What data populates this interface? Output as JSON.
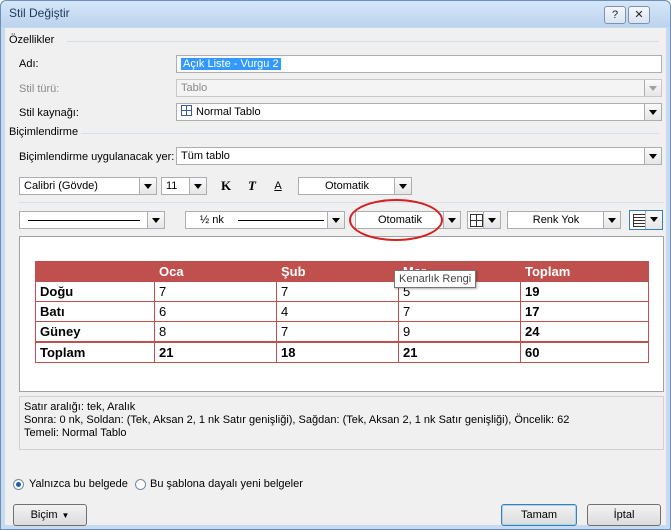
{
  "window": {
    "title": "Stil Değiştir",
    "buttons": [
      "?",
      "✕"
    ]
  },
  "properties": {
    "section": "Özellikler",
    "name_label": "Adı:",
    "name_value": "Açık Liste - Vurgu 2",
    "type_label": "Stil türü:",
    "type_value": "Tablo",
    "base_label": "Stil kaynağı:",
    "base_value": "Normal Tablo"
  },
  "formatting": {
    "section": "Biçimlendirme",
    "apply_label": "Biçimlendirme uygulanacak yer:",
    "apply_value": "Tüm tablo",
    "font_value": "Calibri (Gövde)",
    "size_value": "11",
    "bold_label": "K",
    "italic_label": "T",
    "underline_label": "A",
    "color_value": "Otomatik",
    "line_weight_value": "½ nk",
    "border_color_value": "Otomatik",
    "shading_value": "Renk Yok",
    "tooltip": "Kenarlık Rengi"
  },
  "preview_table": {
    "header": [
      "",
      "Oca",
      "Şub",
      "Mar",
      "Toplam"
    ],
    "rows": [
      [
        "Doğu",
        "7",
        "7",
        "5",
        "19"
      ],
      [
        "Batı",
        "6",
        "4",
        "7",
        "17"
      ],
      [
        "Güney",
        "8",
        "7",
        "9",
        "24"
      ],
      [
        "Toplam",
        "21",
        "18",
        "21",
        "60"
      ]
    ]
  },
  "description": {
    "line1": "Satır aralığı:  tek, Aralık",
    "line2": "Sonra:  0 nk, Soldan:  (Tek, Aksan 2,  1 nk Satır genişliği), Sağdan:  (Tek, Aksan 2,  1 nk Satır genişliği), Öncelik: 62",
    "line3": "Temeli: Normal Tablo"
  },
  "options": {
    "only_this_doc": "Yalnızca bu belgede",
    "new_docs": "Bu şablona dayalı yeni belgeler"
  },
  "footer": {
    "format_button": "Biçim",
    "ok_button": "Tamam",
    "cancel_button": "İptal"
  },
  "colors": {
    "accent": "#c0504d",
    "selection": "#3399ff",
    "annotation": "#d42020"
  }
}
